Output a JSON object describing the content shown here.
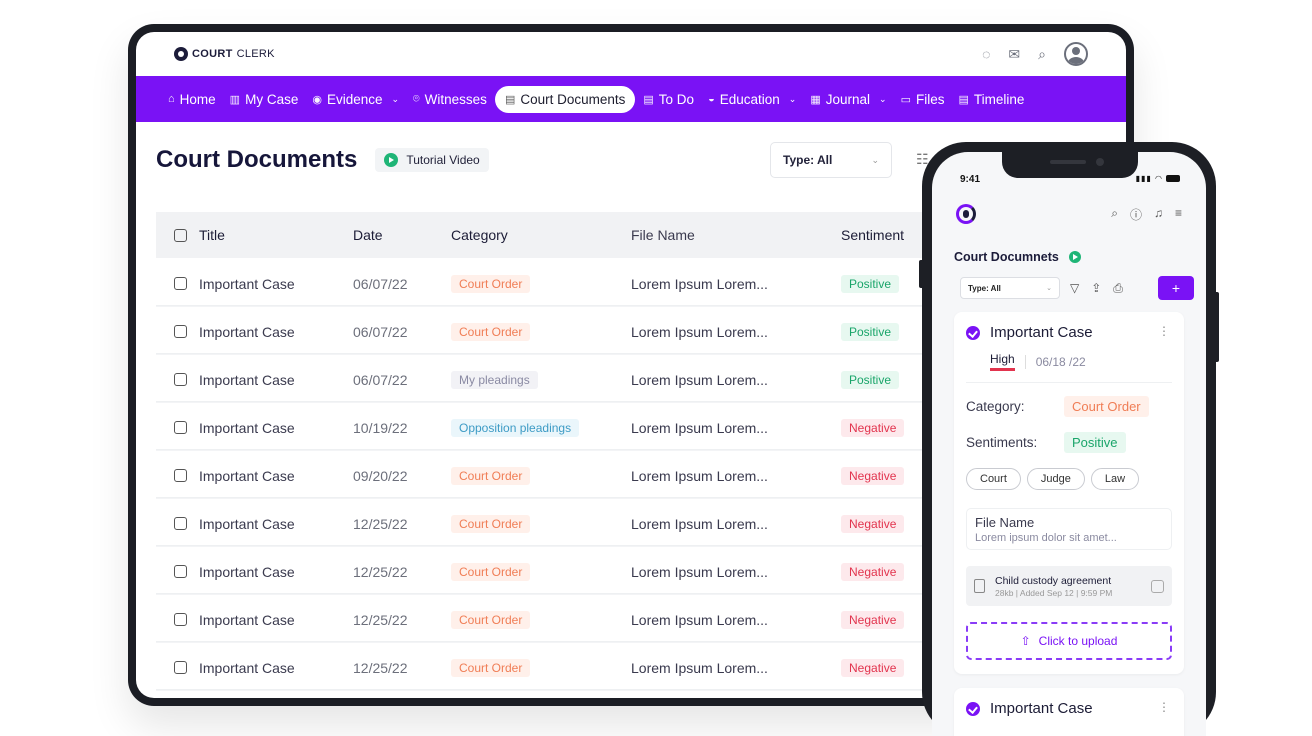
{
  "brand": {
    "logo_bold": "COURT",
    "logo_light": "CLERK"
  },
  "nav": [
    {
      "icon": "⌂",
      "label": "Home",
      "dropdown": false,
      "active": false
    },
    {
      "icon": "▥",
      "label": "My Case",
      "dropdown": false,
      "active": false
    },
    {
      "icon": "◉",
      "label": "Evidence",
      "dropdown": true,
      "active": false
    },
    {
      "icon": "⌾",
      "label": "Witnesses",
      "dropdown": false,
      "active": false
    },
    {
      "icon": "▤",
      "label": "Court Documents",
      "dropdown": false,
      "active": true
    },
    {
      "icon": "▤",
      "label": "To Do",
      "dropdown": false,
      "active": false
    },
    {
      "icon": "◒",
      "label": "Education",
      "dropdown": true,
      "active": false
    },
    {
      "icon": "▦",
      "label": "Journal",
      "dropdown": true,
      "active": false
    },
    {
      "icon": "▭",
      "label": "Files",
      "dropdown": false,
      "active": false
    },
    {
      "icon": "▤",
      "label": "Timeline",
      "dropdown": false,
      "active": false
    }
  ],
  "page": {
    "title": "Court Documents",
    "tutorial_label": "Tutorial Video",
    "type_filter": "Type: All"
  },
  "table": {
    "headers": {
      "title": "Title",
      "date": "Date",
      "category": "Category",
      "file": "File Name",
      "sentiment": "Sentiment"
    },
    "rows": [
      {
        "title": "Important Case",
        "date": "06/07/22",
        "category": "Court Order",
        "cat_style": "order",
        "file": "Lorem Ipsum Lorem...",
        "sentiment": "Positive",
        "sent_style": "pos"
      },
      {
        "title": "Important Case",
        "date": "06/07/22",
        "category": "Court Order",
        "cat_style": "order",
        "file": "Lorem Ipsum Lorem...",
        "sentiment": "Positive",
        "sent_style": "pos"
      },
      {
        "title": "Important Case",
        "date": "06/07/22",
        "category": "My pleadings",
        "cat_style": "plead",
        "file": "Lorem Ipsum Lorem...",
        "sentiment": "Positive",
        "sent_style": "pos"
      },
      {
        "title": "Important Case",
        "date": "10/19/22",
        "category": "Opposition pleadings",
        "cat_style": "oppo",
        "file": "Lorem Ipsum Lorem...",
        "sentiment": "Negative",
        "sent_style": "neg"
      },
      {
        "title": "Important Case",
        "date": "09/20/22",
        "category": "Court Order",
        "cat_style": "order",
        "file": "Lorem Ipsum Lorem...",
        "sentiment": "Negative",
        "sent_style": "neg"
      },
      {
        "title": "Important Case",
        "date": "12/25/22",
        "category": "Court Order",
        "cat_style": "order",
        "file": "Lorem Ipsum Lorem...",
        "sentiment": "Negative",
        "sent_style": "neg"
      },
      {
        "title": "Important Case",
        "date": "12/25/22",
        "category": "Court Order",
        "cat_style": "order",
        "file": "Lorem Ipsum Lorem...",
        "sentiment": "Negative",
        "sent_style": "neg"
      },
      {
        "title": "Important Case",
        "date": "12/25/22",
        "category": "Court Order",
        "cat_style": "order",
        "file": "Lorem Ipsum Lorem...",
        "sentiment": "Negative",
        "sent_style": "neg"
      },
      {
        "title": "Important Case",
        "date": "12/25/22",
        "category": "Court Order",
        "cat_style": "order",
        "file": "Lorem Ipsum Lorem...",
        "sentiment": "Negative",
        "sent_style": "neg"
      }
    ]
  },
  "phone": {
    "time": "9:41",
    "title": "Court Documnets",
    "type_filter": "Type: All",
    "add_label": "+",
    "card": {
      "title": "Important Case",
      "priority": "High",
      "date": "06/18 /22",
      "category_label": "Category:",
      "category": "Court Order",
      "sentiment_label": "Sentiments:",
      "sentiment": "Positive",
      "chips": [
        "Court",
        "Judge",
        "Law"
      ],
      "file_label": "File Name",
      "file_value": "Lorem ipsum dolor sit amet...",
      "attachment_name": "Child custody agreement",
      "attachment_meta": "28kb | Added Sep 12 | 9:59 PM",
      "upload_label": "Click to upload"
    },
    "card2_title": "Important Case"
  },
  "colors": {
    "accent": "#7a12f5",
    "positive": "#1aa56a",
    "negative": "#e2344e",
    "order": "#f07d55"
  }
}
